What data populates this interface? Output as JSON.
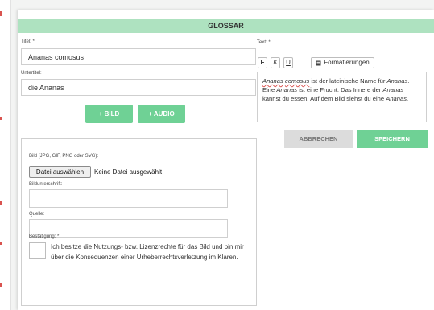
{
  "dialog": {
    "title": "GLOSSAR"
  },
  "form": {
    "title_label": "Titel: *",
    "title_value": "Ananas comosus",
    "subtitle_label": "Untertitel:",
    "subtitle_value": "die Ananas",
    "add_image_label": "BILD",
    "add_audio_label": "AUDIO",
    "plus_glyph": "+"
  },
  "image_upload": {
    "type_label": "Bild (JPG, GIF, PNG oder SVG):",
    "choose_file_label": "Datei auswählen",
    "no_file_text": "Keine Datei ausgewählt",
    "caption_label": "Bildunterschrift:",
    "caption_value": "",
    "source_label": "Quelle:",
    "source_value": "",
    "confirm_label": "Bestätigung: *",
    "confirm_text": "Ich besitze die Nutzungs- bzw. Lizenzrechte für das Bild und bin mir über die Konsequenzen einer Urheberrechtsverletzung im Klaren."
  },
  "text_editor": {
    "label": "Text: *",
    "bold": "F",
    "italic": "K",
    "underline": "U",
    "formatting": "Formatierungen",
    "content": {
      "p1_i1": "Ananas",
      "p1_i2": "comosus",
      "p1_t1": " ist der lateinische Name für ",
      "p1_i3": "Ananas",
      "p1_t2": ". Eine ",
      "p1_i4": "Ananas",
      "p1_t3": " ist eine Frucht. Das Innere der ",
      "p1_i5": "Ananas",
      "p1_t4": " kannst du essen. Auf dem Bild siehst du eine ",
      "p1_i6": "Ananas",
      "p1_t5": "."
    }
  },
  "actions": {
    "cancel": "ABBRECHEN",
    "save": "SPEICHERN"
  },
  "colors": {
    "header": "#aee2c0",
    "accent_green": "#6fd195",
    "line_green": "#3fae6a"
  }
}
